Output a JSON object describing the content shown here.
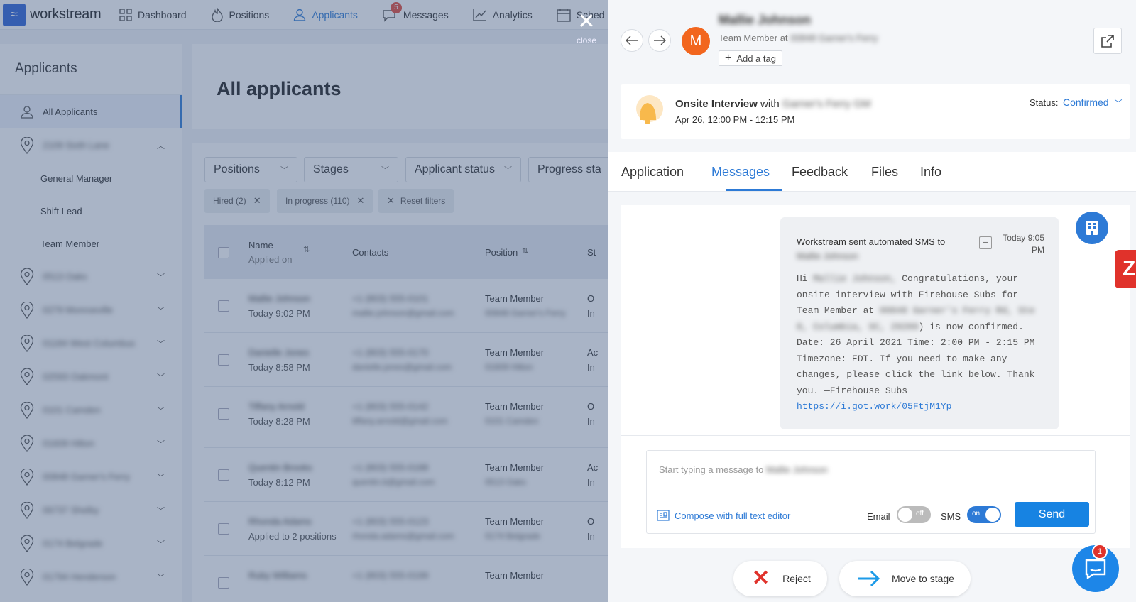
{
  "nav": {
    "logo_text": "workstream",
    "items": [
      {
        "label": "Dashboard",
        "icon": "grid-icon"
      },
      {
        "label": "Positions",
        "icon": "flame-icon"
      },
      {
        "label": "Applicants",
        "icon": "user-icon"
      },
      {
        "label": "Messages",
        "icon": "chat-icon",
        "badge": "5"
      },
      {
        "label": "Analytics",
        "icon": "chart-icon"
      },
      {
        "label": "Sched",
        "icon": "calendar-icon"
      }
    ],
    "active": "Applicants"
  },
  "sidebar": {
    "title": "Applicants",
    "all_label": "All Applicants",
    "location_open": "2109 Sixth Lane",
    "sub_items": [
      "General Manager",
      "Shift Lead",
      "Team Member"
    ],
    "locations": [
      "0513 Oaks",
      "0279 Monroeville",
      "01184 West Columbus",
      "02593 Oakmont",
      "0101 Camden",
      "01609 Hilton",
      "00848 Garner's Ferry",
      "06737 Shelby",
      "0174 Belgrade",
      "01794 Henderson"
    ]
  },
  "main": {
    "title": "All applicants",
    "filters": [
      "Positions",
      "Stages",
      "Applicant status",
      "Progress sta"
    ],
    "chips": [
      "Hired (2)",
      "In progress (110)"
    ],
    "reset_label": "Reset filters",
    "columns": {
      "name": "Name",
      "applied": "Applied on",
      "contacts": "Contacts",
      "position": "Position",
      "st": "St"
    },
    "rows": [
      {
        "name": "Mallie Johnson",
        "date": "Today 9:02 PM",
        "phone": "+1 (803) 555-0101",
        "email": "mallie.johnson@gmail.com",
        "position": "Team Member",
        "location": "00848 Garner's Ferry",
        "s1": "O",
        "s2": "In"
      },
      {
        "name": "Danielle Jones",
        "date": "Today 8:58 PM",
        "phone": "+1 (803) 555-0170",
        "email": "danielle.jones@gmail.com",
        "position": "Team Member",
        "location": "01609 Hilton",
        "s1": "Ac",
        "s2": "In"
      },
      {
        "name": "Tiffany Arnold",
        "date": "Today 8:28 PM",
        "phone": "+1 (803) 555-0142",
        "email": "tiffany.arnold@gmail.com",
        "position": "Team Member",
        "location": "0101 Camden",
        "s1": "O",
        "s2": "In"
      },
      {
        "name": "Quentin Brooks",
        "date": "Today 8:12 PM",
        "phone": "+1 (803) 555-0188",
        "email": "quentin.b@gmail.com",
        "position": "Team Member",
        "location": "0513 Oaks",
        "s1": "Ac",
        "s2": "In"
      },
      {
        "name": "Rhonda Adams",
        "date": "Applied to 2 positions",
        "phone": "+1 (803) 555-0123",
        "email": "rhonda.adams@gmail.com",
        "position": "Team Member",
        "location": "0174 Belgrade",
        "s1": "O",
        "s2": "In"
      },
      {
        "name": "Ruby Williams",
        "date": "",
        "phone": "+1 (803) 555-0199",
        "email": "",
        "position": "Team Member",
        "location": "",
        "s1": "",
        "s2": ""
      }
    ]
  },
  "close_label": "close",
  "drawer": {
    "applicant_name": "Mallie Johnson",
    "avatar_letter": "M",
    "role_prefix": "Team Member at",
    "role_location": "00848 Garner's Ferry",
    "add_tag": "Add a tag",
    "event": {
      "type": "Onsite Interview",
      "with_text": "with",
      "with_who": "Garner's Ferry GM",
      "time": "Apr 26, 12:00 PM - 12:15 PM",
      "status_label": "Status:",
      "status_value": "Confirmed"
    },
    "tabs": [
      "Application",
      "Messages",
      "Feedback",
      "Files",
      "Info"
    ],
    "active_tab": "Messages",
    "message": {
      "header": "Workstream sent automated SMS to",
      "recipient": "Mallie Johnson",
      "time_line1": "Today 9:05",
      "time_line2": "PM",
      "body_hi": "Hi",
      "body_name": "Mallie Johnson,",
      "body_1": " Congratulations, your",
      "body_2": "onsite interview with Firehouse Subs for",
      "body_3": "Team Member at",
      "body_address": "00848 Garner's Ferry Rd, Ste",
      "body_address2": "8, Columbia, SC, 29209",
      "body_4": ") is now confirmed.",
      "body_5": "Date: 26 April 2021 Time: 2:00 PM - 2:15 PM",
      "body_6": "Timezone: EDT. If you need to make any",
      "body_7": "changes, please click the link below. Thank",
      "body_8": "you. —Firehouse Subs",
      "link": "https://i.got.work/05FtjM1Yp"
    },
    "composer": {
      "placeholder": "Start typing a message to",
      "placeholder_name": "Mallie Johnson",
      "editor_label": "Compose with full text editor",
      "email_label": "Email",
      "email_toggle": "off",
      "sms_label": "SMS",
      "sms_toggle": "on",
      "send_label": "Send"
    },
    "actions": {
      "reject": "Reject",
      "move": "Move to stage"
    },
    "chat_badge": "1",
    "colors": {
      "accent": "#2d7ad6",
      "avatar": "#f2661e",
      "reject": "#e0322b"
    }
  }
}
